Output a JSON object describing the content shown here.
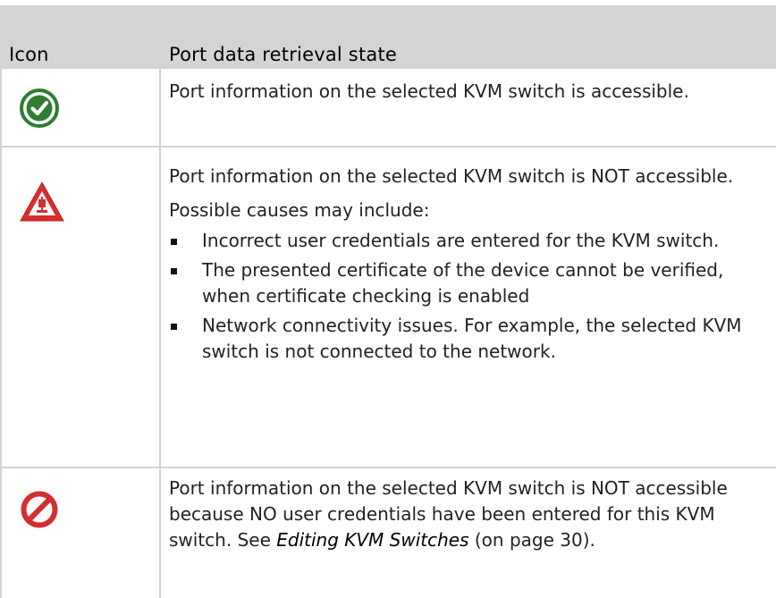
{
  "header": {
    "col_icon": "Icon",
    "col_state": "Port data retrieval state"
  },
  "rows": [
    {
      "icon": "check-circle-icon",
      "icon_color": "#2e7d32",
      "text": "Port information on the selected KVM switch is accessible."
    },
    {
      "icon": "warning-triangle-icon",
      "icon_color": "#d32f2f",
      "text": "Port information on the selected KVM switch is NOT accessible.",
      "subheading": "Possible causes may include:",
      "bullets": [
        "Incorrect user credentials are entered for the KVM switch.",
        "The presented certificate of the device cannot be verified, when certificate checking is enabled",
        "Network connectivity issues. For example, the selected KVM switch is not connected to the network."
      ]
    },
    {
      "icon": "prohibited-icon",
      "icon_color": "#d32f2f",
      "text_before": "Port information on the selected KVM switch is NOT accessible because NO user credentials have been entered for this KVM switch. See ",
      "link": "Editing KVM Switches",
      "text_after": " (on page 30)."
    }
  ]
}
